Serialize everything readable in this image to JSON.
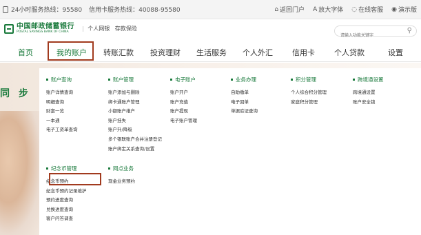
{
  "topbar": {
    "hotline": "24小时服务热线：95580",
    "card_hotline": "信用卡服务热线：40088-95580",
    "links": [
      {
        "icon": "home-icon",
        "label": "返回门户"
      },
      {
        "icon": "font-size-icon",
        "label": "放大字体"
      },
      {
        "icon": "chat-icon",
        "label": "在线客服"
      },
      {
        "icon": "eye-icon",
        "label": "演示版"
      }
    ]
  },
  "header": {
    "logo_cn": "中国邮政储蓄银行",
    "logo_en": "POSTAL SAVINGS BANK OF CHINA",
    "section1": "个人网银",
    "section2": "存款保险",
    "search_placeholder": "请输入功能关键字"
  },
  "nav": {
    "tabs": [
      "首页",
      "我的账户",
      "转账汇款",
      "投资理财",
      "生活服务",
      "个人外汇",
      "信用卡",
      "个人贷款",
      "设置"
    ],
    "active": "我的账户"
  },
  "banner": {
    "slogan": "同 步"
  },
  "dropdown": {
    "groups": [
      {
        "title": "账户查询",
        "items": [
          "账户详情查询",
          "明细查询",
          "财富一览",
          "一本通",
          "电子工资单查询"
        ]
      },
      {
        "title": "账户管理",
        "items": [
          "账户添加与删除",
          "绑卡通账户管理",
          "小额账户维户",
          "账户挂失",
          "账户升/降级",
          "多个银联账户合并注册登记",
          "账户绑定关系查询/设置"
        ]
      },
      {
        "title": "电子账户",
        "items": [
          "账户开户",
          "账户充值",
          "账户提现",
          "电子账户管理"
        ]
      },
      {
        "title": "业务办理",
        "items": [
          "自助缴单",
          "电子回单",
          "单据验证查询"
        ]
      },
      {
        "title": "积分管理",
        "items": [
          "个人综合积分管理",
          "家庭积分管理"
        ]
      },
      {
        "title": "跨境通设置",
        "items": [
          "跨境通设置",
          "账户安全锁"
        ]
      },
      {
        "title": "纪念币管理",
        "items": [
          "纪念币预约",
          "纪念币预约记录维护",
          "预约进度查询",
          "兑换进度查询",
          "客户问答调查"
        ]
      },
      {
        "title": "网点业务",
        "items": [
          "现金业务预约"
        ]
      }
    ]
  }
}
